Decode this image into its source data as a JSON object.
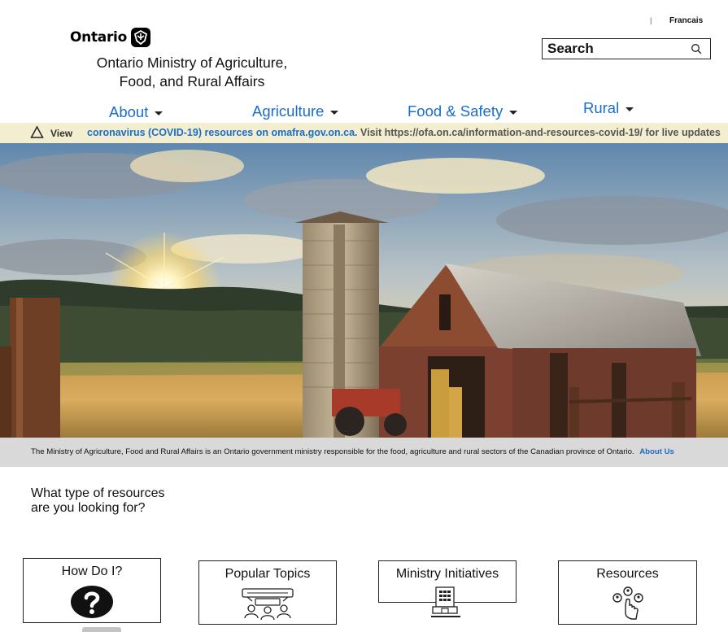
{
  "header": {
    "language_separator": "|",
    "language_link": "Francais",
    "logo_word": "Ontario",
    "ministry_title": "Ontario Ministry of Agriculture, Food, and Rural Affairs",
    "search_placeholder": "Search"
  },
  "nav": [
    {
      "label": "About"
    },
    {
      "label": "Agriculture"
    },
    {
      "label": "Food & Safety"
    },
    {
      "label": "Rural"
    }
  ],
  "alert": {
    "view_label": "View",
    "link_text": "coronavirus (COVID-19) resources on omafra.gov.on.ca.",
    "text": "Visit https://ofa.on.ca/information-and-resources-covid-19/ for live updates"
  },
  "about": {
    "text": "The Ministry of Agriculture, Food and Rural Affairs is an Ontario government ministry responsible for the food, agriculture and rural sectors of the Canadian province of Ontario.",
    "link": "About Us"
  },
  "resources": {
    "question": "What type of resources are you looking for?",
    "cards": [
      {
        "label": "How Do I?",
        "icon": "question-icon"
      },
      {
        "label": "Popular Topics",
        "icon": "discussion-icon"
      },
      {
        "label": "Ministry Initiatives",
        "icon": "building-icon"
      },
      {
        "label": "Resources",
        "icon": "resources-hand-icon"
      }
    ]
  },
  "colors": {
    "link_blue": "#1a6dc9",
    "alert_background": "#f3eed0",
    "about_strip_background": "#d9d9d9"
  }
}
